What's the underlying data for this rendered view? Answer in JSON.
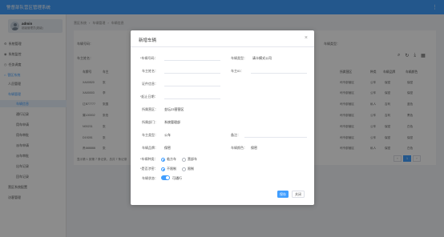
{
  "app": {
    "title": "警督部队营区管理系统",
    "more_icon": "more-vertical-icon"
  },
  "user": {
    "name": "admin",
    "role": "超级管理员(超级)"
  },
  "sidebar": {
    "items": [
      {
        "label": "系统管理",
        "icon": "gear-icon",
        "state": "normal"
      },
      {
        "label": "系统监控",
        "icon": "monitor-icon",
        "state": "normal"
      },
      {
        "label": "任务调度",
        "icon": "clock-icon",
        "state": "normal"
      },
      {
        "label": "营区系统",
        "icon": "home-icon",
        "state": "active"
      },
      {
        "label": "人员管理",
        "icon": "",
        "state": "normal"
      },
      {
        "label": "车辆管理",
        "icon": "",
        "state": "active"
      },
      {
        "label": "车辆信息",
        "icon": "",
        "state": "selected"
      },
      {
        "label": "通行记录",
        "icon": "",
        "state": "normal"
      },
      {
        "label": "用车申请",
        "icon": "",
        "state": "normal"
      },
      {
        "label": "用车审批",
        "icon": "",
        "state": "normal"
      },
      {
        "label": "派车申请",
        "icon": "",
        "state": "normal"
      },
      {
        "label": "派车审批",
        "icon": "",
        "state": "normal"
      },
      {
        "label": "出车记录",
        "icon": "",
        "state": "normal"
      },
      {
        "label": "回车记录",
        "icon": "",
        "state": "normal"
      },
      {
        "label": "营区系统配置",
        "icon": "",
        "state": "normal"
      },
      {
        "label": "访客管理",
        "icon": "",
        "state": "normal"
      }
    ]
  },
  "breadcrumb": [
    "营区系统",
    "车辆管理",
    "车辆信息"
  ],
  "filters": {
    "plate_label": "车辆号码：",
    "owner_label": "车主姓名：",
    "type_label": "车辆类型："
  },
  "table": {
    "icons": [
      "search-icon",
      "refresh-icon",
      "download-icon",
      "grid-icon"
    ],
    "headers": [
      "车牌号",
      "车主",
      "所属营区",
      "种类",
      "车辆品牌",
      "车辆颜色"
    ],
    "rows": [
      {
        "plate": "XA00520",
        "owner": "张",
        "camp": "司令部营区",
        "kind": "公车",
        "brand": "保密",
        "color": "保密"
      },
      {
        "plate": "XA00003",
        "owner": "李",
        "camp": "司令部营区",
        "kind": "公车",
        "brand": "保密",
        "color": "保密"
      },
      {
        "plate": "辽B77777",
        "owner": "张国",
        "camp": "司令部营区",
        "kind": "私人",
        "brand": "吉利",
        "color": "蓝色"
      },
      {
        "plate": "冀L00002",
        "owner": "张伯",
        "camp": "司令部营区",
        "kind": "公车",
        "brand": "吉利",
        "color": "黑色"
      },
      {
        "plate": "N00231",
        "owner": "张",
        "camp": "司令部营区",
        "kind": "公车",
        "brand": "保密",
        "color": "白色"
      },
      {
        "plate": "D19281",
        "owner": "张",
        "camp": "司令部营区",
        "kind": "公车",
        "brand": "保密",
        "color": "保密"
      },
      {
        "plate": "贵A66666",
        "owner": "张",
        "camp": "司令部营区",
        "kind": "私人",
        "brand": "保密",
        "color": "白色"
      }
    ],
    "pagination": {
      "summary": "显示第 1 到第 7 条记录，总共 7 条记录",
      "current": "1"
    }
  },
  "footer": {
    "text": "© 营区系统 All rights reserved."
  },
  "dialog": {
    "title": "新增车辆",
    "close_icon": "close-icon",
    "fields": {
      "plate": {
        "label": "*车辆号码：",
        "value": ""
      },
      "type": {
        "label": "车辆类型：",
        "value": "请卡模式公司"
      },
      "owner": {
        "label": "车主姓名：",
        "value": ""
      },
      "owner_id": {
        "label": "车主ID：",
        "value": ""
      },
      "cert": {
        "label": "证件信息：",
        "value": ""
      },
      "start_date": {
        "label": "*起止日期：",
        "value": ""
      },
      "camp": {
        "label": "所属营区：",
        "value": "金坛23营营区"
      },
      "dept": {
        "label": "所属部门：",
        "value": "系统管理部"
      },
      "kind": {
        "label": "车主类型：",
        "value": "公车"
      },
      "remark": {
        "label": "备注：",
        "value": ""
      },
      "brand": {
        "label": "车辆品牌：",
        "value": "保密"
      },
      "color": {
        "label": "车辆颜色：",
        "value": "保密"
      }
    },
    "radio_groups": [
      {
        "label": "*车辆种类：",
        "options": [
          "临方车",
          "营部车"
        ],
        "selected": 0
      },
      {
        "label": "*是否涉密：",
        "options": [
          "不限制",
          "限制"
        ],
        "selected": 0
      }
    ],
    "switch": {
      "label": "车辆状态：",
      "value": "可通行"
    },
    "buttons": {
      "save": "保存",
      "cancel": "关闭"
    }
  }
}
